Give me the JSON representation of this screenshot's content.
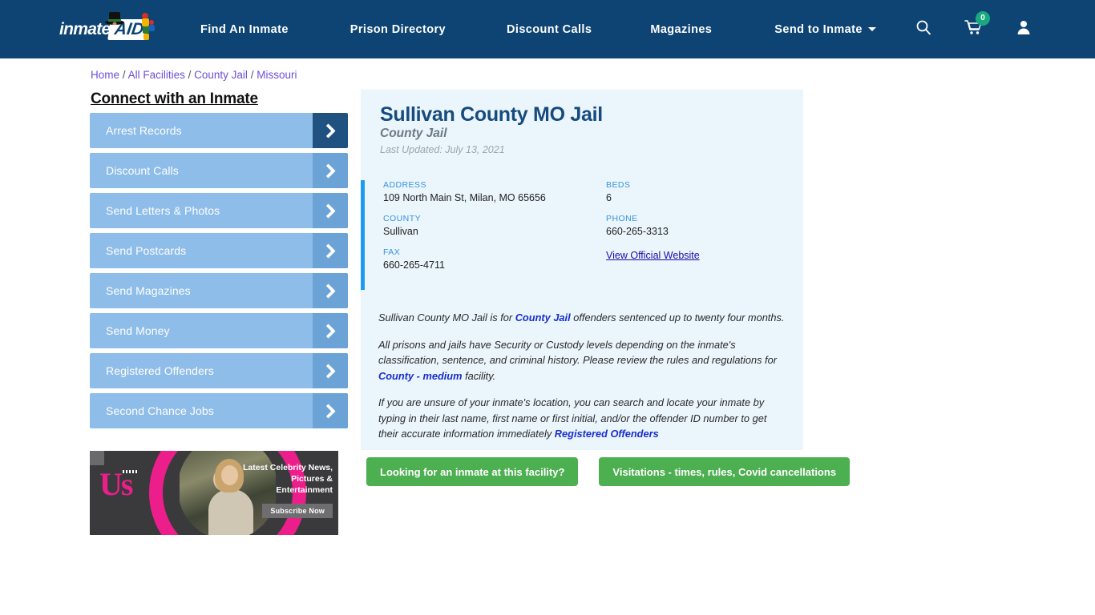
{
  "header": {
    "logo": {
      "word": "inmate",
      "box": "AID",
      "alt": "InmateAid logo"
    },
    "nav": [
      {
        "label": "Find An Inmate",
        "caret": false
      },
      {
        "label": "Prison Directory",
        "caret": false
      },
      {
        "label": "Discount Calls",
        "caret": false
      },
      {
        "label": "Magazines",
        "caret": false
      },
      {
        "label": "Send to Inmate",
        "caret": true
      }
    ],
    "icons": {
      "search": "search-icon",
      "cart": "cart-icon",
      "cart_count": "0",
      "account": "user-icon"
    },
    "bg_color": "#0d4473",
    "badge_color": "#19a97f"
  },
  "breadcrumb": {
    "items": [
      "Home",
      "All Facilities",
      "County Jail",
      "Missouri"
    ],
    "separator": "/",
    "link_color": "#6b4fd8"
  },
  "sidebar": {
    "title": "Connect with an Inmate",
    "items": [
      {
        "label": "Arrest Records",
        "active": true
      },
      {
        "label": "Discount Calls",
        "active": false
      },
      {
        "label": "Send Letters & Photos",
        "active": false
      },
      {
        "label": "Send Postcards",
        "active": false
      },
      {
        "label": "Send Magazines",
        "active": false
      },
      {
        "label": "Send Money",
        "active": false
      },
      {
        "label": "Registered Offenders",
        "active": false
      },
      {
        "label": "Second Chance Jobs",
        "active": false
      }
    ],
    "item_bg": "#8fbde9",
    "arrow_bg": "#6ba3d6",
    "arrow_bg_active": "#1f5181"
  },
  "ad": {
    "brand": "Us",
    "headline": "Latest Celebrity News, Pictures & Entertainment",
    "cta": "Subscribe Now",
    "accent_color": "#ec1e8c"
  },
  "facility": {
    "name": "Sullivan County MO Jail",
    "type": "County Jail",
    "last_updated": "Last Updated: July 13, 2021",
    "details": [
      {
        "label": "ADDRESS",
        "value": "109 North Main St, Milan, MO 65656",
        "link": false
      },
      {
        "label": "BEDS",
        "value": "6",
        "link": false
      },
      {
        "label": "COUNTY",
        "value": "Sullivan",
        "link": false
      },
      {
        "label": "PHONE",
        "value": "660-265-3313",
        "link": false
      },
      {
        "label": "FAX",
        "value": "660-265-4711",
        "link": false
      },
      {
        "label": "",
        "value": "View Official Website",
        "link": true
      }
    ],
    "accent_bar_color": "#1e9bf0",
    "card_bg": "#eaf5fc"
  },
  "description": {
    "p1_a": "Sullivan County MO Jail is for ",
    "p1_link": "County Jail",
    "p1_b": " offenders sentenced up to twenty four months.",
    "p2_a": "All prisons and jails have Security or Custody levels depending on the inmate's classification, sentence, and criminal history. Please review the rules and regulations for ",
    "p2_link": "County - medium",
    "p2_b": " facility.",
    "p3_a": "If you are unsure of your inmate's location, you can search and locate your inmate by typing in their last name, first name or first initial, and/or the offender ID number to get their accurate information immediately ",
    "p3_link": "Registered Offenders",
    "p3_b": ""
  },
  "cta_buttons": [
    {
      "label": "Looking for an inmate at this facility?"
    },
    {
      "label": "Visitations - times, rules, Covid cancellations"
    }
  ],
  "colors": {
    "green": "#4caf50",
    "brand_blue": "#0d4473",
    "link_blue": "#1a2ed0"
  }
}
